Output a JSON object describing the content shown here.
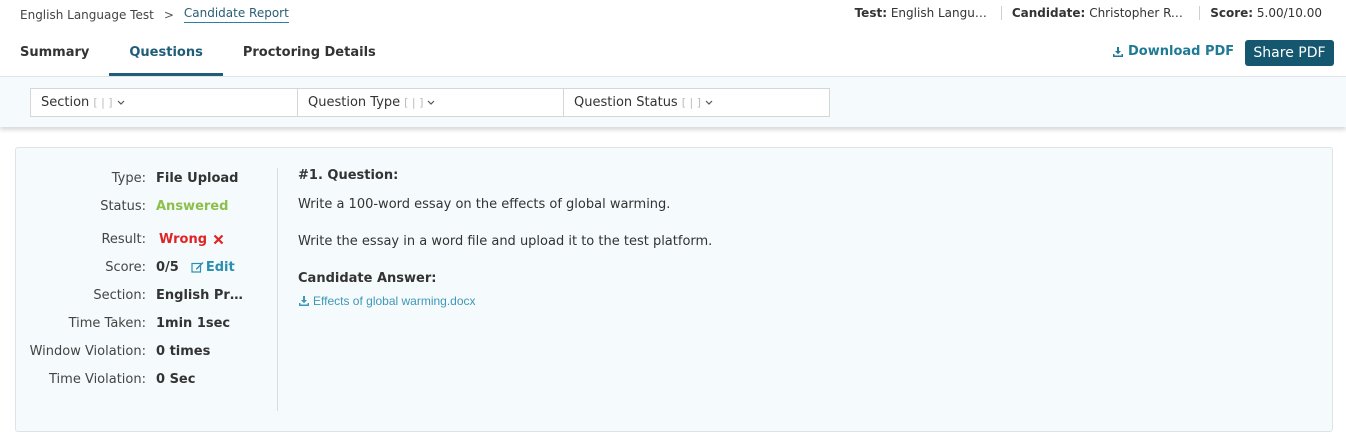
{
  "breadcrumb": {
    "parent": "English Language Test",
    "separator": ">",
    "current": "Candidate Report"
  },
  "header": {
    "test_label": "Test:",
    "test_value": "English Languag...",
    "candidate_label": "Candidate:",
    "candidate_value": "Christopher Ree...",
    "score_label": "Score:",
    "score_value": "5.00/10.00"
  },
  "tabs": [
    {
      "label": "Summary",
      "active": false
    },
    {
      "label": "Questions",
      "active": true
    },
    {
      "label": "Proctoring Details",
      "active": false
    }
  ],
  "actions": {
    "download_label": "Download PDF",
    "share_label": "Share PDF"
  },
  "filters": [
    {
      "label": "Section",
      "brackets": "[ | ]"
    },
    {
      "label": "Question Type",
      "brackets": "[ | ]"
    },
    {
      "label": "Question Status",
      "brackets": "[ | ]"
    }
  ],
  "question": {
    "type_label": "Type:",
    "type_value": "File Upload",
    "status_label": "Status:",
    "status_value": "Answered",
    "result_label": "Result:",
    "result_value": "Wrong",
    "score_label": "Score:",
    "score_value": "0/5",
    "edit_label": "Edit",
    "section_label": "Section:",
    "section_value": "English Prof...",
    "time_taken_label": "Time Taken:",
    "time_taken_value": "1min 1sec",
    "window_violation_label": "Window Violation:",
    "window_violation_value": "0 times",
    "time_violation_label": "Time Violation:",
    "time_violation_value": "0 Sec",
    "title": "#1. Question:",
    "text_1": "Write a 100-word essay on the effects of global warming.",
    "text_2": "Write the essay in a word file and upload it to the test platform.",
    "answer_title": "Candidate Answer:",
    "answer_file": "Effects of global warming.docx"
  },
  "colors": {
    "accent": "#14576e",
    "link": "#2a8fb0",
    "answered": "#8cc04b",
    "wrong": "#e02424"
  },
  "icons": {
    "download": "download-icon",
    "edit": "edit-icon",
    "wrong": "close-icon",
    "chevron": "chevron-down-icon"
  }
}
